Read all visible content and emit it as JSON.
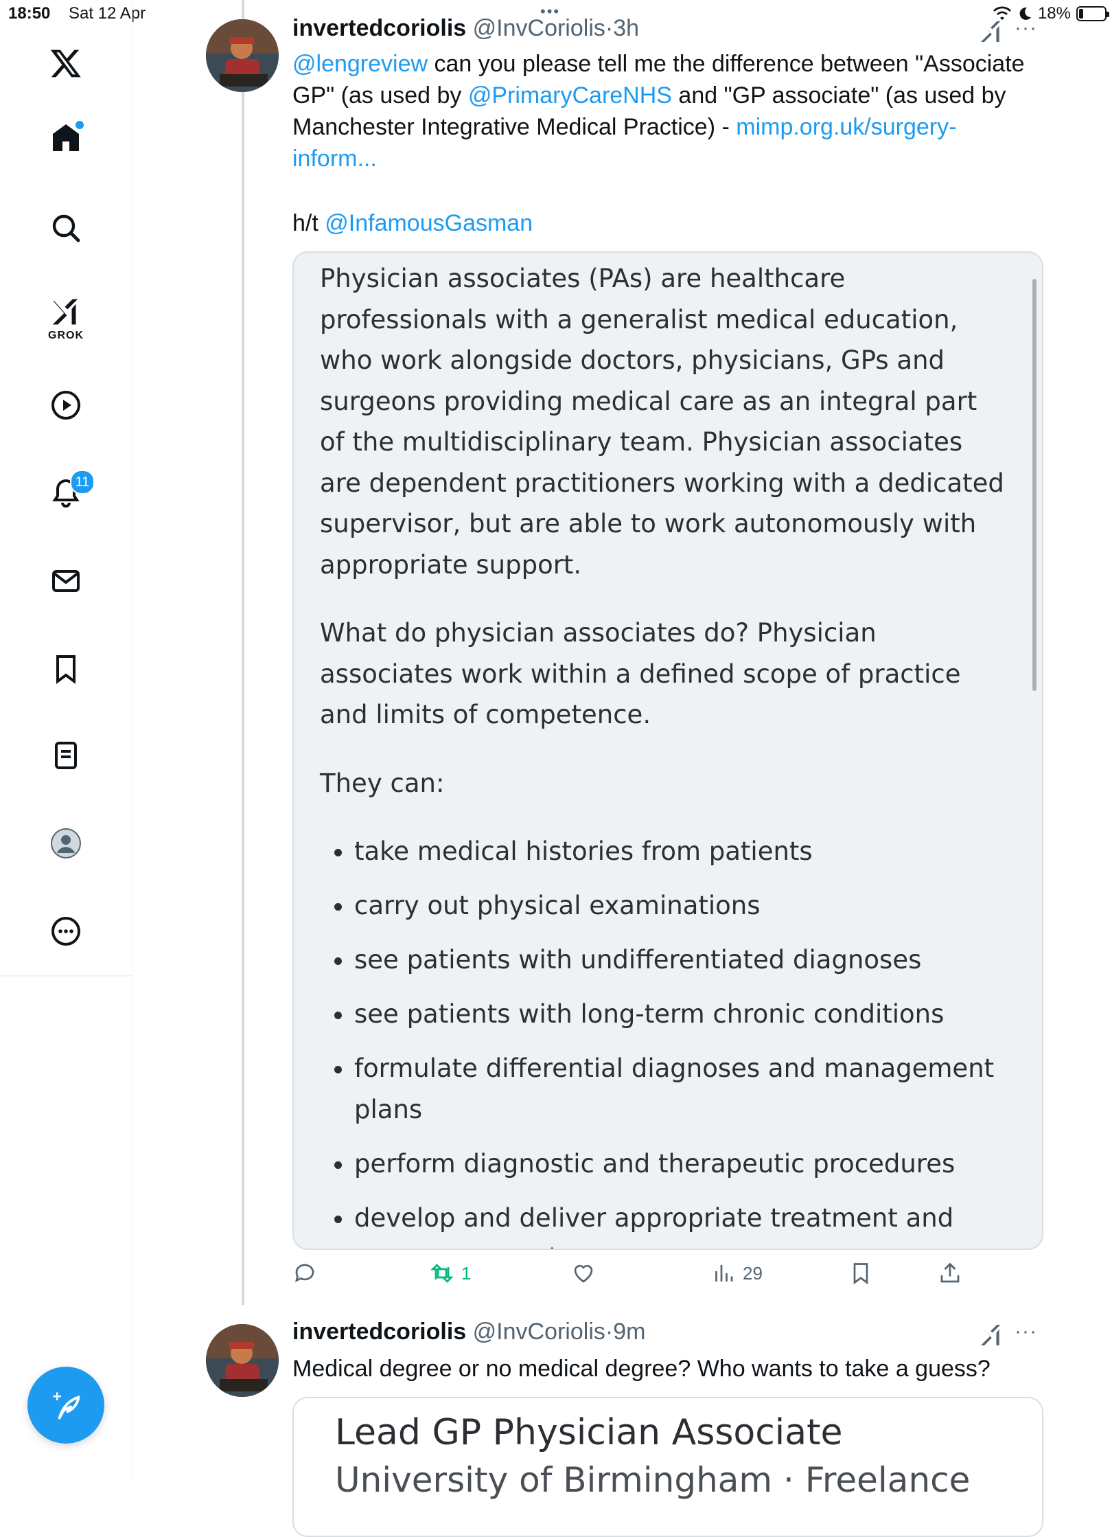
{
  "status_bar": {
    "time": "18:50",
    "date": "Sat 12 Apr",
    "battery": "18%",
    "battery_level": 0.18
  },
  "sidebar": {
    "items": [
      {
        "name": "x-logo-icon"
      },
      {
        "name": "home-icon",
        "has_dot": true
      },
      {
        "name": "search-icon"
      },
      {
        "name": "grok-icon",
        "label": "GROK"
      },
      {
        "name": "video-icon"
      },
      {
        "name": "notifications-icon",
        "badge": "11"
      },
      {
        "name": "messages-icon"
      },
      {
        "name": "bookmarks-icon"
      },
      {
        "name": "lists-icon"
      },
      {
        "name": "profile-icon"
      },
      {
        "name": "more-icon"
      }
    ],
    "compose": "compose-icon"
  },
  "tweet1": {
    "display_name": "invertedcoriolis",
    "handle": "@InvCoriolis",
    "time": "3h",
    "mention1": "@lengreview",
    "text1": " can you please tell me the difference between \"Associate GP\" (as used by ",
    "mention2": "@PrimaryCareNHS",
    "text2": " and \"GP associate\" (as used by Manchester Integrative Medical Practice) - ",
    "link": "mimp.org.uk/surgery-inform...",
    "ht_prefix": "h/t ",
    "ht_mention": "@InfamousGasman",
    "quote": {
      "para1": "Physician associates (PAs) are healthcare professionals with a generalist medical education, who work alongside doctors, physicians, GPs and surgeons providing medical care as an integral part of the multidisciplinary team. Physician associates are dependent practitioners working with a dedicated supervisor, but are able to work autonomously with appropriate support.",
      "para2": "What do physician associates do? Physician associates work within a defined scope of practice and limits of competence.",
      "para3": "They can:",
      "bullets": [
        "take medical histories from patients",
        "carry out physical examinations",
        "see patients with undifferentiated diagnoses",
        "see patients with long-term chronic conditions",
        "formulate differential diagnoses and management plans",
        "perform diagnostic and therapeutic procedures",
        "develop and deliver appropriate treatment and management plans"
      ]
    },
    "actions": {
      "retweets": "1",
      "views": "29"
    }
  },
  "tweet2": {
    "display_name": "invertedcoriolis",
    "handle": "@InvCoriolis",
    "time": "9m",
    "text": "Medical degree or no medical degree? Who wants to take a guess?",
    "card_title": "Lead GP Physician Associate",
    "card_sub": "University of Birmingham  ·  Freelance"
  },
  "colors": {
    "accent": "#1d9bf0",
    "retweet_green": "#00ba7c",
    "muted": "#536471"
  }
}
